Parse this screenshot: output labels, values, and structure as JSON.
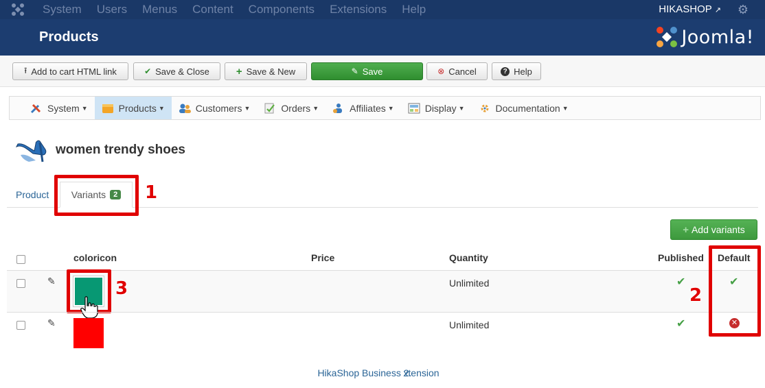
{
  "topbar": {
    "menu": [
      "System",
      "Users",
      "Menus",
      "Content",
      "Components",
      "Extensions",
      "Help"
    ],
    "site_name": "HIKASHOP"
  },
  "header": {
    "title": "Products",
    "brand_text": "Joomla!"
  },
  "toolbar": {
    "add_to_cart": "Add to cart HTML link",
    "save_close": "Save & Close",
    "save_new": "Save & New",
    "save": "Save",
    "cancel": "Cancel",
    "help": "Help"
  },
  "hikamenu": {
    "items": [
      {
        "label": "System",
        "icon": "tools-icon"
      },
      {
        "label": "Products",
        "icon": "box-icon",
        "active": true
      },
      {
        "label": "Customers",
        "icon": "customers-icon"
      },
      {
        "label": "Orders",
        "icon": "orders-icon"
      },
      {
        "label": "Affiliates",
        "icon": "affiliates-icon"
      },
      {
        "label": "Display",
        "icon": "display-icon"
      },
      {
        "label": "Documentation",
        "icon": "documentation-icon"
      }
    ]
  },
  "product": {
    "name": "women trendy shoes"
  },
  "tabs": {
    "product": "Product",
    "variants": "Variants",
    "variants_count": "2"
  },
  "add_variants_label": "Add variants",
  "table": {
    "headers": {
      "coloricon": "coloricon",
      "price": "Price",
      "quantity": "Quantity",
      "published": "Published",
      "default": "Default"
    },
    "rows": [
      {
        "color": "#079873",
        "price": "",
        "quantity": "Unlimited",
        "published": true,
        "default": true
      },
      {
        "color": "#ff0000",
        "price": "",
        "quantity": "Unlimited",
        "published": true,
        "default": false
      }
    ]
  },
  "annotations": {
    "one": "1",
    "two": "2",
    "three": "3"
  },
  "footer": "HikaShop Business 2.<hikashop_version>",
  "footer_visible": "HikaShop Business 2.\u0000xtension",
  "colors": {
    "topbar": "#1a3867",
    "header": "#1c3d70",
    "accent_green": "#3d993d",
    "annotation_red": "#e00000"
  }
}
